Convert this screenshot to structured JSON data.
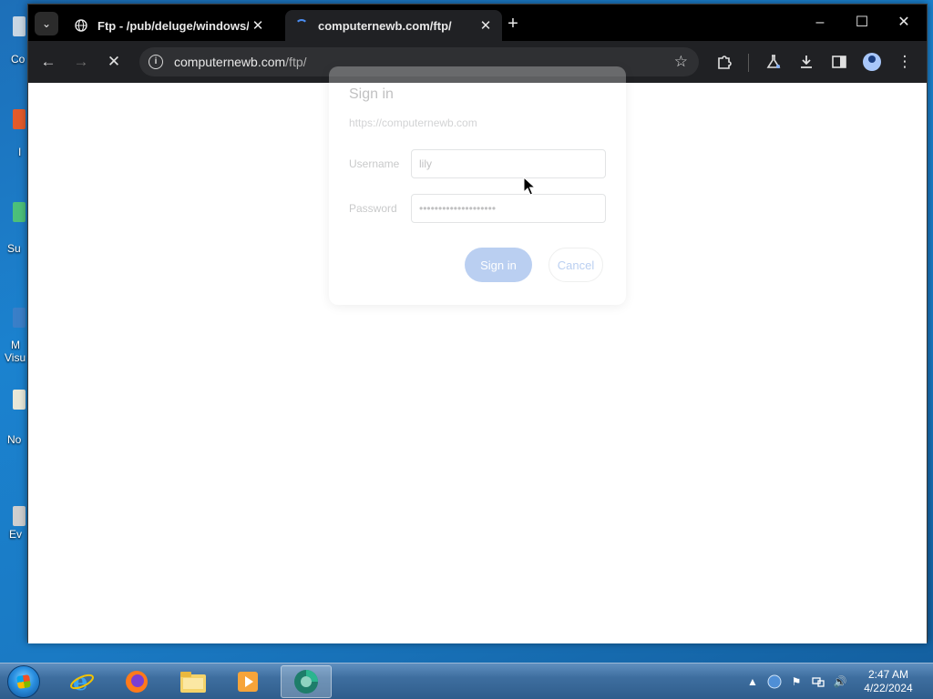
{
  "desktop": {
    "icons": [
      {
        "label": "Co"
      },
      {
        "label": "I"
      },
      {
        "label": "Su"
      },
      {
        "label": "M"
      },
      {
        "label": "Visu"
      },
      {
        "label": "No"
      },
      {
        "label": "Ev"
      }
    ]
  },
  "browser": {
    "tabs": [
      {
        "title": "Ftp - /pub/deluge/windows/ ::",
        "active": false
      },
      {
        "title": "computernewb.com/ftp/",
        "active": true
      }
    ],
    "address": {
      "host": "computernewb.com",
      "path": "/ftp/"
    },
    "window_controls": {
      "minimize": "–",
      "maximize": "☐",
      "close": "✕"
    }
  },
  "dialog": {
    "title": "Sign in",
    "origin": "https://computernewb.com",
    "username_label": "Username",
    "username_value": "lily",
    "password_label": "Password",
    "password_value": "••••••••••••••••••••",
    "signin_label": "Sign in",
    "cancel_label": "Cancel"
  },
  "taskbar": {
    "time": "2:47 AM",
    "date": "4/22/2024"
  },
  "colors": {
    "accent": "#0b57d0",
    "titlebar": "#000000",
    "toolbar": "#202124"
  }
}
